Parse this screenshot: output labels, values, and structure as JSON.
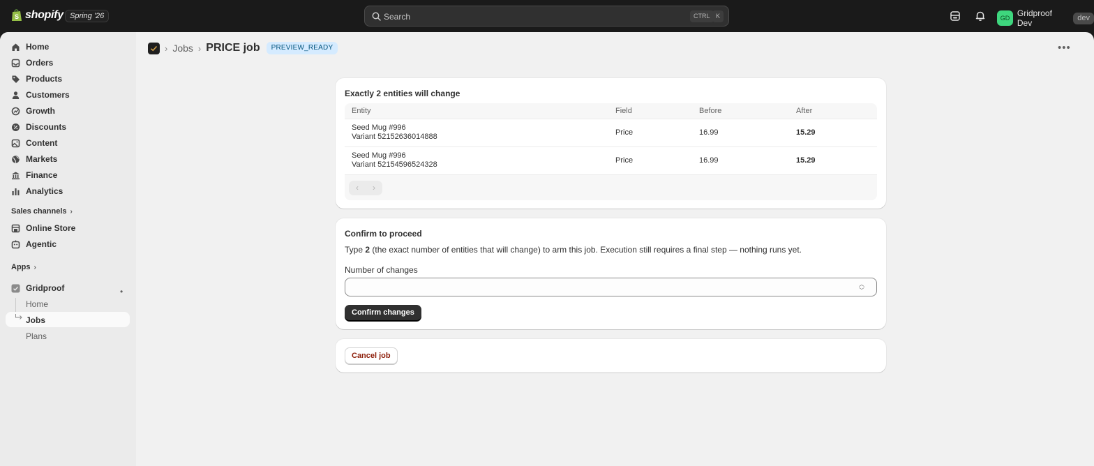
{
  "topbar": {
    "logo_text": "shopify",
    "edition": "Spring '26",
    "search_placeholder": "Search",
    "shortcut_ctrl": "CTRL",
    "shortcut_k": "K",
    "user_initials": "GD",
    "user_name": "Gridproof Dev",
    "dev_badge": "dev",
    "avatar_color": "#3ed67e"
  },
  "sidebar": {
    "items": [
      {
        "label": "Home",
        "icon": "home-icon"
      },
      {
        "label": "Orders",
        "icon": "inbox-icon"
      },
      {
        "label": "Products",
        "icon": "tag-icon"
      },
      {
        "label": "Customers",
        "icon": "person-icon"
      },
      {
        "label": "Growth",
        "icon": "growth-icon"
      },
      {
        "label": "Discounts",
        "icon": "discount-icon"
      },
      {
        "label": "Content",
        "icon": "content-icon"
      },
      {
        "label": "Markets",
        "icon": "globe-icon"
      },
      {
        "label": "Finance",
        "icon": "bank-icon"
      },
      {
        "label": "Analytics",
        "icon": "bar-chart-icon"
      }
    ],
    "sales_channels_label": "Sales channels",
    "channels": [
      {
        "label": "Online Store",
        "icon": "store-icon"
      },
      {
        "label": "Agentic",
        "icon": "agentic-icon"
      }
    ],
    "apps_label": "Apps",
    "app_name": "Gridproof",
    "app_dot": "•",
    "app_sub_items": [
      "Home",
      "Jobs",
      "Plans"
    ]
  },
  "page": {
    "breadcrumb_link": "Jobs",
    "title": "PRICE job",
    "status": "PREVIEW_READY",
    "status_color": "#d5ebff"
  },
  "changes_card": {
    "title": "Exactly 2 entities will change",
    "columns": [
      "Entity",
      "Field",
      "Before",
      "After"
    ],
    "rows": [
      {
        "entity": "Seed Mug #996",
        "variant": "Variant 52152636014888",
        "field": "Price",
        "before": "16.99",
        "after": "15.29"
      },
      {
        "entity": "Seed Mug #996",
        "variant": "Variant 52154596524328",
        "field": "Price",
        "before": "16.99",
        "after": "15.29"
      }
    ]
  },
  "confirm_card": {
    "title": "Confirm to proceed",
    "desc_prefix": "Type ",
    "desc_count": "2",
    "desc_suffix": " (the exact number of entities that will change) to arm this job. Execution still requires a final step — nothing runs yet.",
    "field_label": "Number of changes",
    "input_value": "",
    "button_label": "Confirm changes"
  },
  "cancel_card": {
    "button_label": "Cancel job",
    "danger_color": "#8e1f0b"
  }
}
